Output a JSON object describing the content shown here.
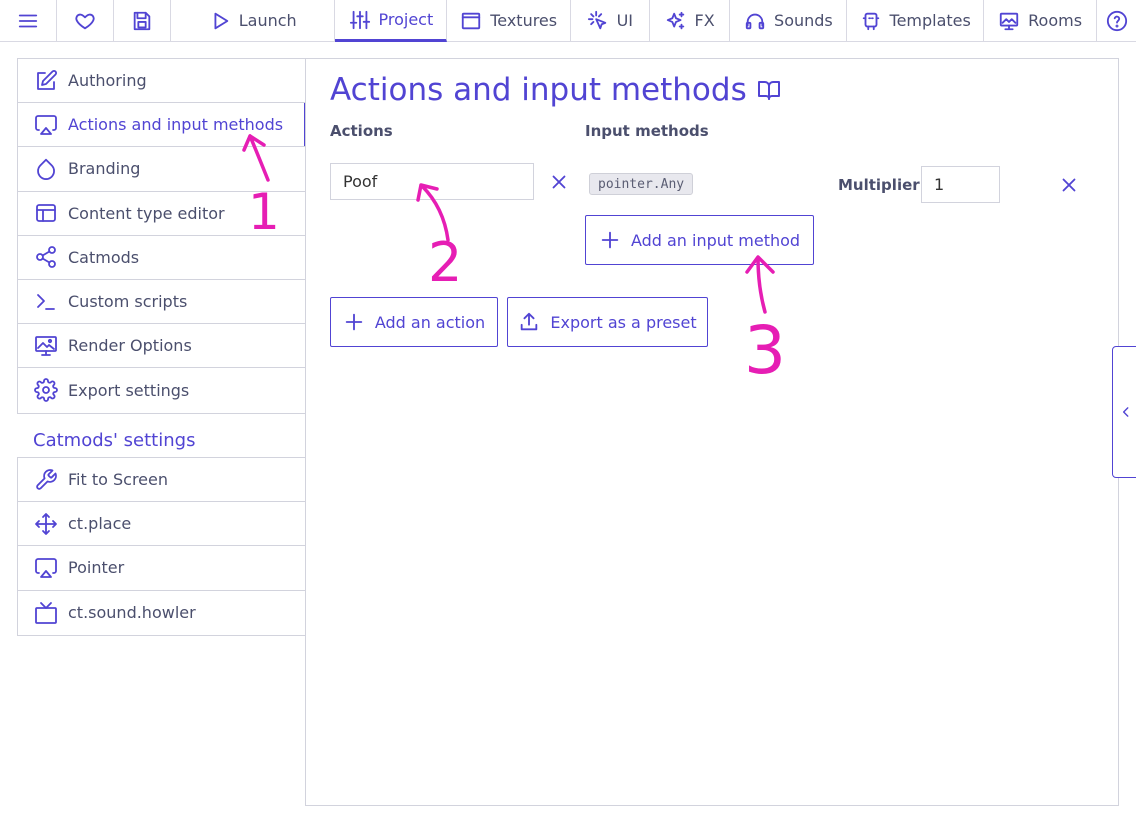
{
  "topnav": {
    "items": [
      {
        "label": "",
        "icon": "hamburger-menu-icon"
      },
      {
        "label": "",
        "icon": "heart-icon"
      },
      {
        "label": "",
        "icon": "save-icon"
      },
      {
        "label": "Launch",
        "icon": "play-icon"
      },
      {
        "label": "Project",
        "icon": "sliders-icon",
        "active": true
      },
      {
        "label": "Textures",
        "icon": "texture-icon"
      },
      {
        "label": "UI",
        "icon": "cursor-click-icon"
      },
      {
        "label": "FX",
        "icon": "sparkles-icon"
      },
      {
        "label": "Sounds",
        "icon": "headphones-icon"
      },
      {
        "label": "Templates",
        "icon": "template-icon"
      },
      {
        "label": "Rooms",
        "icon": "room-icon"
      },
      {
        "label": "",
        "icon": "help-icon"
      }
    ]
  },
  "sidebar": {
    "items": [
      {
        "label": "Authoring",
        "icon": "edit-icon"
      },
      {
        "label": "Actions and input methods",
        "icon": "airplay-icon",
        "active": true
      },
      {
        "label": "Branding",
        "icon": "droplet-icon"
      },
      {
        "label": "Content type editor",
        "icon": "layout-icon"
      },
      {
        "label": "Catmods",
        "icon": "share-nodes-icon"
      },
      {
        "label": "Custom scripts",
        "icon": "terminal-icon"
      },
      {
        "label": "Render Options",
        "icon": "monitor-image-icon"
      },
      {
        "label": "Export settings",
        "icon": "gear-icon"
      }
    ],
    "catmods_heading": "Catmods' settings",
    "catmods": [
      {
        "label": "Fit to Screen",
        "icon": "wrench-icon"
      },
      {
        "label": "ct.place",
        "icon": "move-arrows-icon"
      },
      {
        "label": "Pointer",
        "icon": "airplay-icon"
      },
      {
        "label": "ct.sound.howler",
        "icon": "tv-icon"
      }
    ]
  },
  "main": {
    "title": "Actions and input methods",
    "actions_header": "Actions",
    "input_methods_header": "Input methods",
    "action": {
      "name": "Poof",
      "method": "pointer.Any",
      "multiplier_label": "Multiplier:",
      "multiplier_value": "1"
    },
    "add_input_method_label": "Add an input method",
    "add_action_label": "Add an action",
    "export_preset_label": "Export as a preset"
  },
  "annotations": {
    "labels": [
      "1",
      "2",
      "3"
    ],
    "color": "#e61eb4"
  },
  "colors": {
    "accent": "#5144d3",
    "text": "#4b4f6d",
    "border": "#d2d3dd"
  }
}
